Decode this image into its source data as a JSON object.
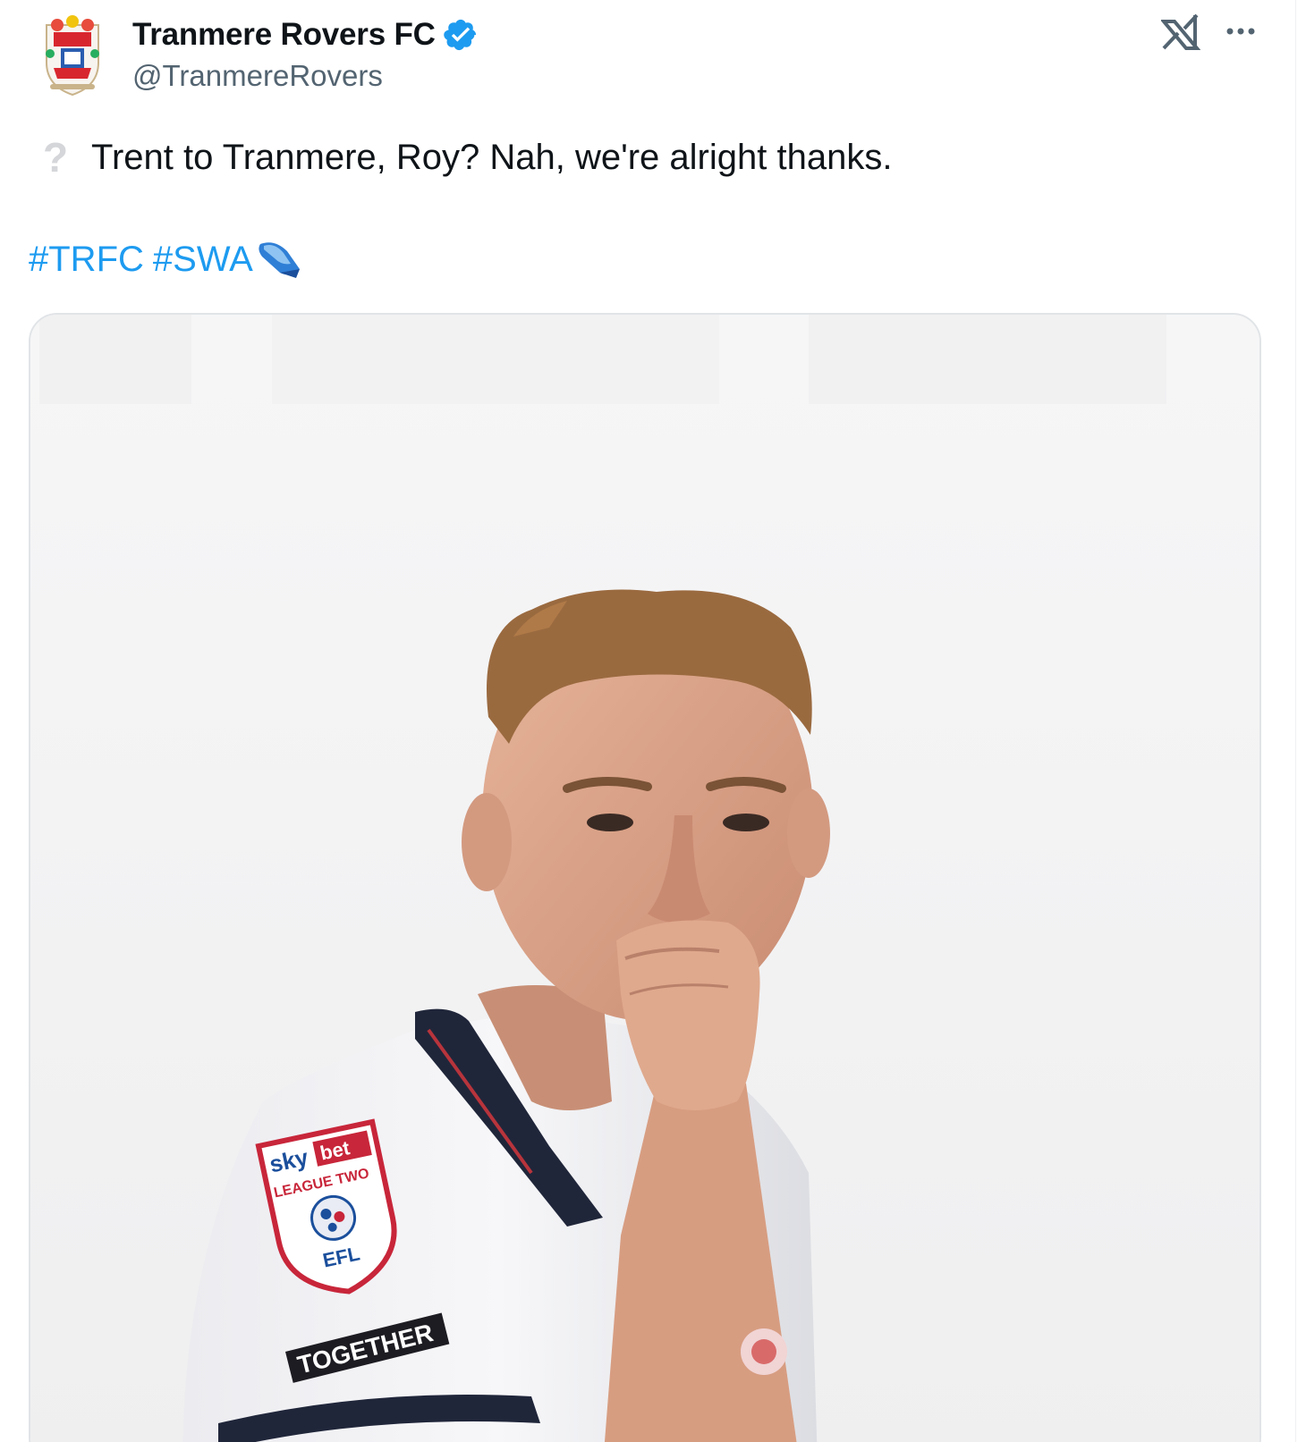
{
  "account": {
    "display_name": "Tranmere Rovers FC",
    "handle": "@TranmereRovers",
    "verified": true,
    "avatar_icon": "club-crest-icon",
    "verified_icon": "verified-badge-icon",
    "verified_color": "#1d9bf0"
  },
  "header_actions": {
    "logo_icon": "x-logo-icon",
    "more_icon": "more-options-icon"
  },
  "tweet": {
    "emoji_icon": "question-mark-emoji",
    "emoji_glyph": "?",
    "text": "Trent to Tranmere, Roy? Nah, we're alright thanks.",
    "hashtags": [
      "#TRFC",
      "#SWA"
    ],
    "hashtag_icon": "swa-emoji-icon",
    "link_color": "#1d9bf0"
  },
  "media": {
    "kind": "photo",
    "subject": "footballer-kissing-fist-photo",
    "sleeve_badge": {
      "sponsor_sky": "sky",
      "sponsor_bet": "bet",
      "league": "LEAGUE TWO",
      "org": "EFL"
    },
    "sleeve_text": "TOGETHER"
  }
}
